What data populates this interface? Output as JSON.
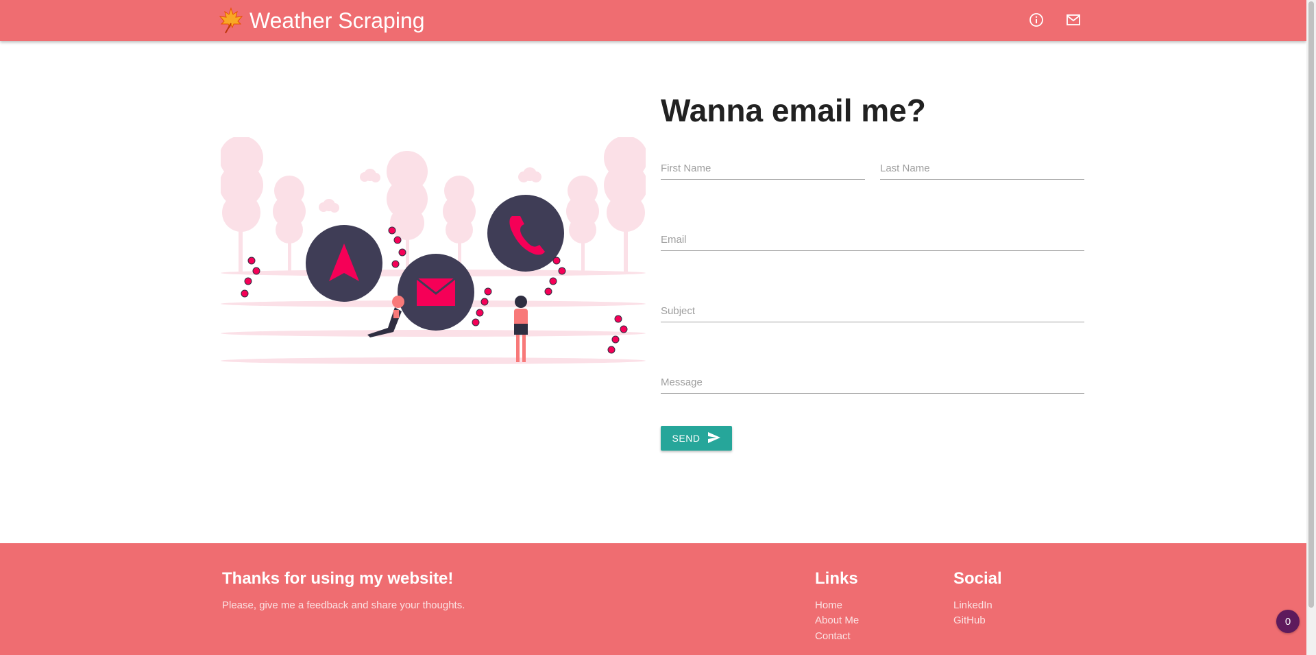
{
  "header": {
    "title": "Weather Scraping",
    "logo_icon": "maple-leaf-icon",
    "nav_icons": [
      "info-icon",
      "mail-icon"
    ]
  },
  "contact": {
    "heading": "Wanna email me?",
    "first_name_placeholder": "First Name",
    "last_name_placeholder": "Last Name",
    "email_placeholder": "Email",
    "subject_placeholder": "Subject",
    "message_placeholder": "Message",
    "send_label": "SEND"
  },
  "footer": {
    "title": "Thanks for using my website!",
    "text": "Please, give me a feedback and share your thoughts.",
    "links_title": "Links",
    "links": [
      "Home",
      "About Me",
      "Contact"
    ],
    "social_title": "Social",
    "social": [
      "LinkedIn",
      "GitHub"
    ]
  },
  "badge": {
    "count": "0"
  },
  "colors": {
    "primary": "#ef6d71",
    "accent": "#26a69a",
    "illustration_pink": "#f50057",
    "illustration_dark": "#3f3d56"
  }
}
